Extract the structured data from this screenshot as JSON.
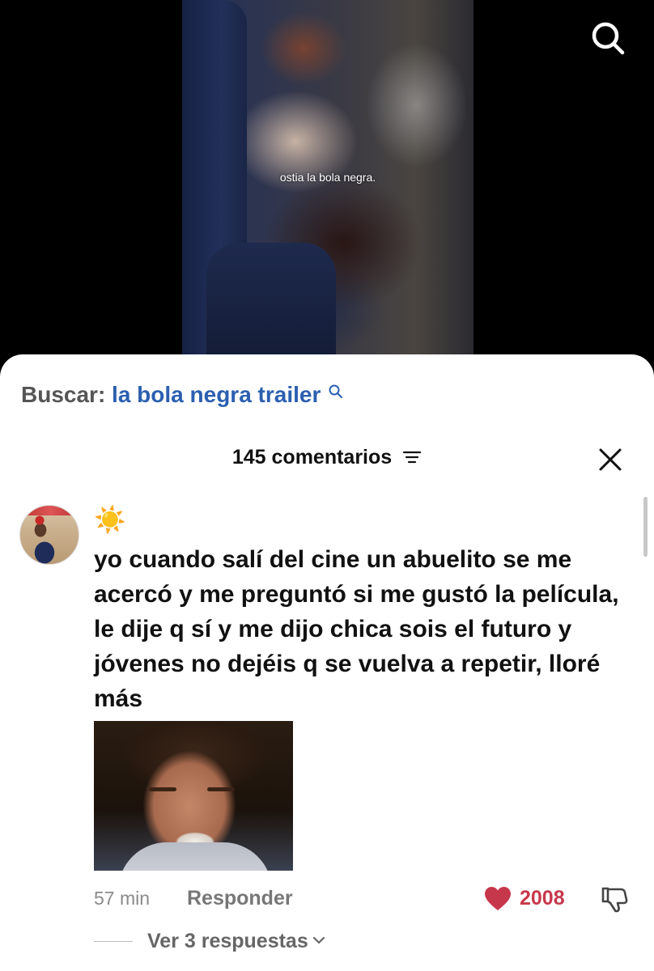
{
  "video": {
    "subtitle": "ostia la bola negra."
  },
  "search_suggestion": {
    "prefix": "Buscar:",
    "term": "la bola negra trailer",
    "accent_color": "#2b5fb0"
  },
  "comments_panel": {
    "title": "145 comentarios",
    "comment": {
      "username": "☀️",
      "text": "yo cuando salí del cine un abuelito se me acercó y me preguntó si me gustó la película, le dije q sí y me dijo chica sois el futuro y jóvenes no dejéis q se vuelva a repetir, lloré más",
      "time": "57 min",
      "reply_label": "Responder",
      "likes": "2008",
      "like_color": "#c7374c",
      "view_replies_label": "Ver 3 respuestas"
    }
  },
  "icons": {
    "search": "search-icon",
    "filter": "filter-icon",
    "close": "close-icon",
    "like": "heart-icon",
    "dislike": "thumbs-down-icon",
    "expand": "chevron-down-icon"
  }
}
